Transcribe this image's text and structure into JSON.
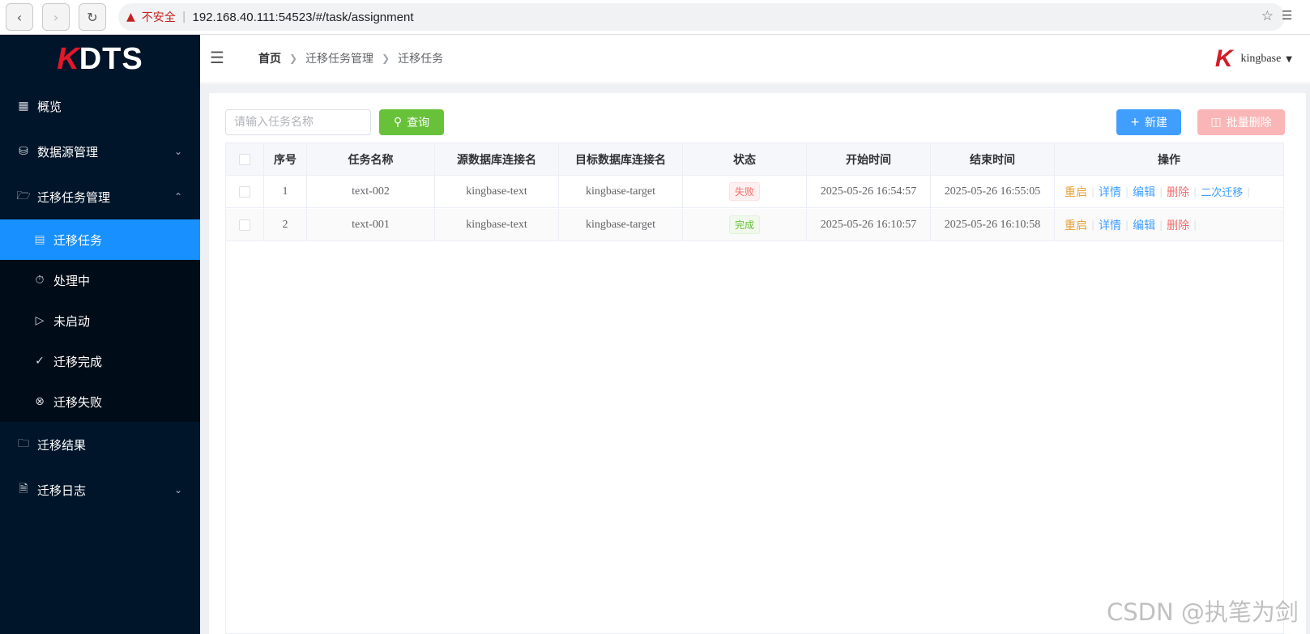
{
  "browser": {
    "insecure_label": "不安全",
    "url": "192.168.40.111:54523/#/task/assignment"
  },
  "sidebar": {
    "logo_k": "K",
    "logo_rest": "DTS",
    "items": [
      {
        "label": "概览",
        "icon": "grid-icon"
      },
      {
        "label": "数据源管理",
        "icon": "database-icon"
      },
      {
        "label": "迁移任务管理",
        "icon": "folder-open-icon"
      },
      {
        "label": "迁移结果",
        "icon": "folder-check-icon"
      },
      {
        "label": "迁移日志",
        "icon": "document-icon"
      }
    ],
    "subitems": [
      {
        "label": "迁移任务",
        "icon": "book-icon",
        "active": true
      },
      {
        "label": "处理中",
        "icon": "timer-icon"
      },
      {
        "label": "未启动",
        "icon": "play-circle-icon"
      },
      {
        "label": "迁移完成",
        "icon": "check-list-icon"
      },
      {
        "label": "迁移失败",
        "icon": "close-circle-icon"
      }
    ]
  },
  "header": {
    "breadcrumb": [
      "首页",
      "迁移任务管理",
      "迁移任务"
    ],
    "username": "kingbase"
  },
  "toolbar": {
    "search_placeholder": "请输入任务名称",
    "query_label": "查询",
    "new_label": "新建",
    "batch_delete_label": "批量删除"
  },
  "table": {
    "columns": [
      "序号",
      "任务名称",
      "源数据库连接名",
      "目标数据库连接名",
      "状态",
      "开始时间",
      "结束时间",
      "操作"
    ],
    "rows": [
      {
        "index": "1",
        "name": "text-002",
        "source": "kingbase-text",
        "target": "kingbase-target",
        "status": "失败",
        "start": "2025-05-26 16:54:57",
        "end": "2025-05-26 16:55:05"
      },
      {
        "index": "2",
        "name": "text-001",
        "source": "kingbase-text",
        "target": "kingbase-target",
        "status": "完成",
        "start": "2025-05-26 16:10:57",
        "end": "2025-05-26 16:10:58"
      }
    ],
    "actions": {
      "restart": "重启",
      "detail": "详情",
      "edit": "编辑",
      "delete": "删除",
      "second": "二次迁移"
    }
  },
  "watermark": "CSDN @执笔为剑",
  "colors": {
    "sidebar_bg": "#001529",
    "active_item": "#1890ff",
    "query_btn": "#67c23a",
    "new_btn": "#409eff",
    "batch_delete_btn": "#fab6b6",
    "fail_tag": "#f56c6c",
    "done_tag": "#67c23a"
  }
}
